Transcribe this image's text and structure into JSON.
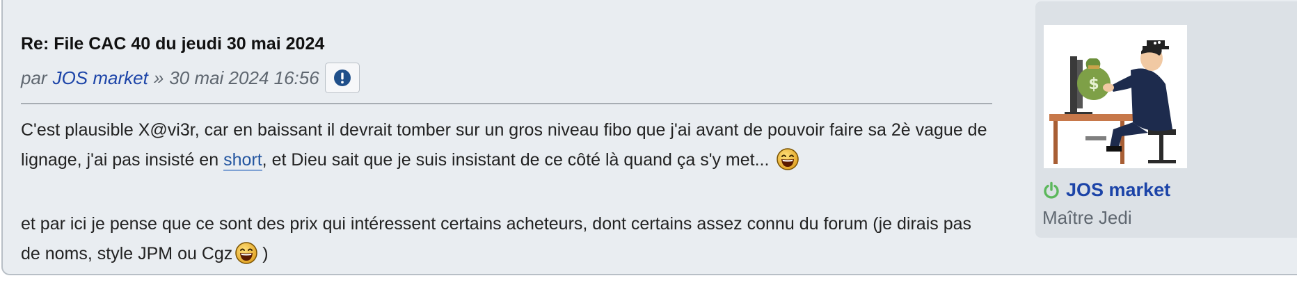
{
  "post": {
    "title": "Re: File CAC 40 du jeudi 30 mai 2024",
    "by_label": "par",
    "author": "JOS market",
    "separator": "»",
    "datetime": "30 mai 2024 16:56",
    "report_icon": "exclamation-circle-icon"
  },
  "content": {
    "p1_part1": "C'est plausible X@vi3r, car en baissant il devrait tomber sur un gros niveau fibo que j'ai avant de pouvoir faire sa 2è vague de lignage, j'ai pas insisté en ",
    "p1_link": "short",
    "p1_part2": ", et Dieu sait que je suis insistant de ce côté là quand ça s'y met...",
    "p2_part1": "et par ici je pense que ce sont des prix qui intéressent certains acheteurs, dont certains assez connu du forum (je dirais pas de noms, style JPM ou Cgz",
    "p2_part2": ")",
    "emoji": "laughing-smiley-icon"
  },
  "profile": {
    "username": "JOS market",
    "rank": "Maître Jedi",
    "online_icon": "power-online-icon",
    "online_color": "#5cb85c"
  },
  "colors": {
    "link": "#1c44a8",
    "background": "#e9edf1",
    "profile_background": "#dce1e6"
  }
}
